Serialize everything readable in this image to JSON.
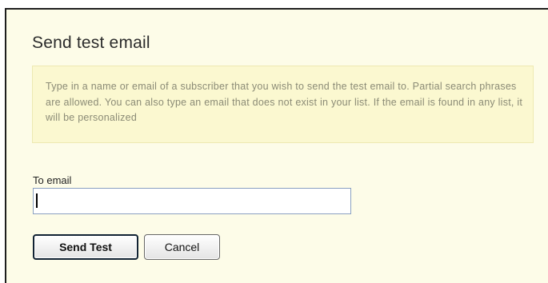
{
  "dialog": {
    "title": "Send test email",
    "notice": "Type in a name or email of a subscriber that you wish to send the test email to. Partial search phrases are allowed. You can also type an email that does not exist in your list. If the email is found in any list, it will be personalized",
    "to_email_label": "To email",
    "to_email_value": "",
    "send_button": "Send Test",
    "cancel_button": "Cancel"
  },
  "colors": {
    "dialog_background": "#fdfce8",
    "notice_background": "#fbf8d0",
    "notice_text": "#8b8b76"
  }
}
